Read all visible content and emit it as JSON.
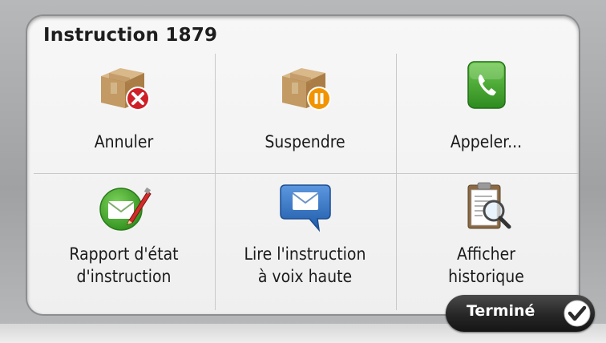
{
  "dialog": {
    "title": "Instruction 1879"
  },
  "actions": [
    {
      "label": "Annuler",
      "icon": "package-cancel-icon"
    },
    {
      "label": "Suspendre",
      "icon": "package-pause-icon"
    },
    {
      "label": "Appeler...",
      "icon": "phone-icon"
    },
    {
      "label_line1": "Rapport d'état",
      "label_line2": "d'instruction",
      "icon": "envelope-edit-icon"
    },
    {
      "label_line1": "Lire l'instruction",
      "label_line2": "à voix haute",
      "icon": "message-bubble-icon"
    },
    {
      "label_line1": "Afficher",
      "label_line2": "historique",
      "icon": "clipboard-magnifier-icon"
    }
  ],
  "footer": {
    "done_label": "Terminé",
    "done_icon": "checkmark-icon"
  },
  "colors": {
    "panel": "#f3f3f3",
    "button_dark": "#262626",
    "phone_green": "#39a12a",
    "envelope_blue": "#2b69b8",
    "cancel_red": "#c81e22",
    "pause_orange": "#f29400"
  }
}
